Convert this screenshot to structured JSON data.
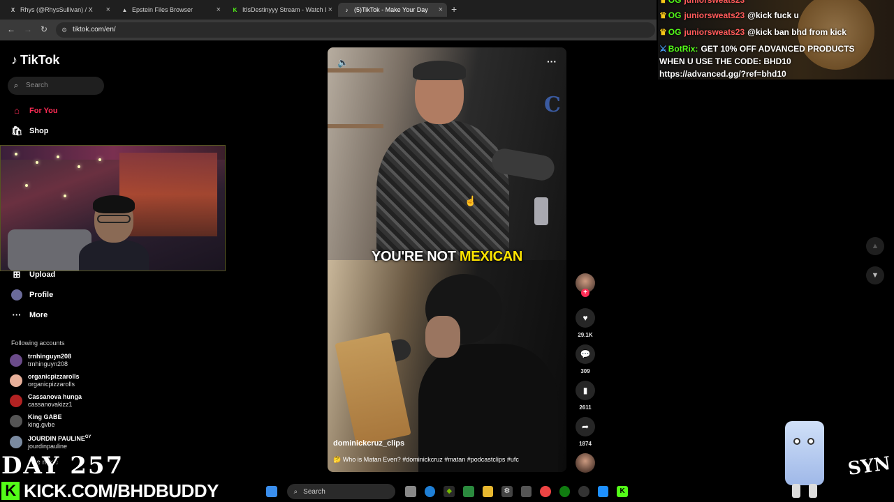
{
  "browser": {
    "tabs": [
      {
        "label": "Rhys (@RhysSullivan) / X",
        "favicon": "X"
      },
      {
        "label": "Epstein Files Browser",
        "favicon": "▲"
      },
      {
        "label": "ItIsDestinyyy Stream - Watch Li",
        "favicon": "K"
      },
      {
        "label": "(5)TikTok - Make Your Day",
        "favicon": "♪"
      }
    ],
    "url": "tiktok.com/en/"
  },
  "tiktok": {
    "logo": "TikTok",
    "search_placeholder": "Search",
    "nav": [
      {
        "label": "For You",
        "icon": "home-icon"
      },
      {
        "label": "Shop",
        "icon": "shop-icon"
      },
      {
        "label": "Upload",
        "icon": "upload-icon"
      },
      {
        "label": "Profile",
        "icon": "profile-icon"
      },
      {
        "label": "More",
        "icon": "more-icon"
      }
    ],
    "following_header": "Following accounts",
    "following": [
      {
        "name": "trnhinguyn208",
        "handle": "trnhinguyn208",
        "color": "#6b4b8a"
      },
      {
        "name": "organicpizzarolls",
        "handle": "organicpizzarolls",
        "color": "#e8b09a"
      },
      {
        "name": "Cassanova hunga",
        "handle": "cassanovakizz1",
        "color": "#b22222"
      },
      {
        "name": "King GABE",
        "handle": "king.gvbe",
        "color": "#555555"
      },
      {
        "name": "JOURDIN PAULINE",
        "handle": "jourdinpauline",
        "color": "#7a8aa0",
        "badge": "GY"
      }
    ],
    "see_more": "See more"
  },
  "video": {
    "caption_white": "YOU'RE NOT ",
    "caption_yellow": "MEXICAN",
    "author": "dominickcruz_clips",
    "description": "🤔 Who is Matan Even? #dominickcruz #matan #podcastclips #ufc",
    "likes": "29.1K",
    "comments": "309",
    "saves": "2611",
    "shares": "1874"
  },
  "chat": [
    {
      "user": "juniorsweats23",
      "msg": "@kick fuck u"
    },
    {
      "user": "juniorsweats23",
      "msg": "@kick ban bhd from kick"
    },
    {
      "user": "BotRix:",
      "msg": "GET 10% OFF ADVANCED PRODUCTS",
      "msg2": "WHEN U USE THE CODE: BHD10",
      "msg3": "https://advanced.gg/?ref=bhd10"
    }
  ],
  "overlay": {
    "day": "DAY 257",
    "kick_url": "KICK.COM/BHDBUDDY",
    "kick_logo": "K",
    "brand_mark": "SYN"
  },
  "taskbar": {
    "search_label": "Search"
  },
  "colors": {
    "tiktok_red": "#fe2c55",
    "kick_green": "#53fc18",
    "caption_yellow": "#ffe400"
  }
}
